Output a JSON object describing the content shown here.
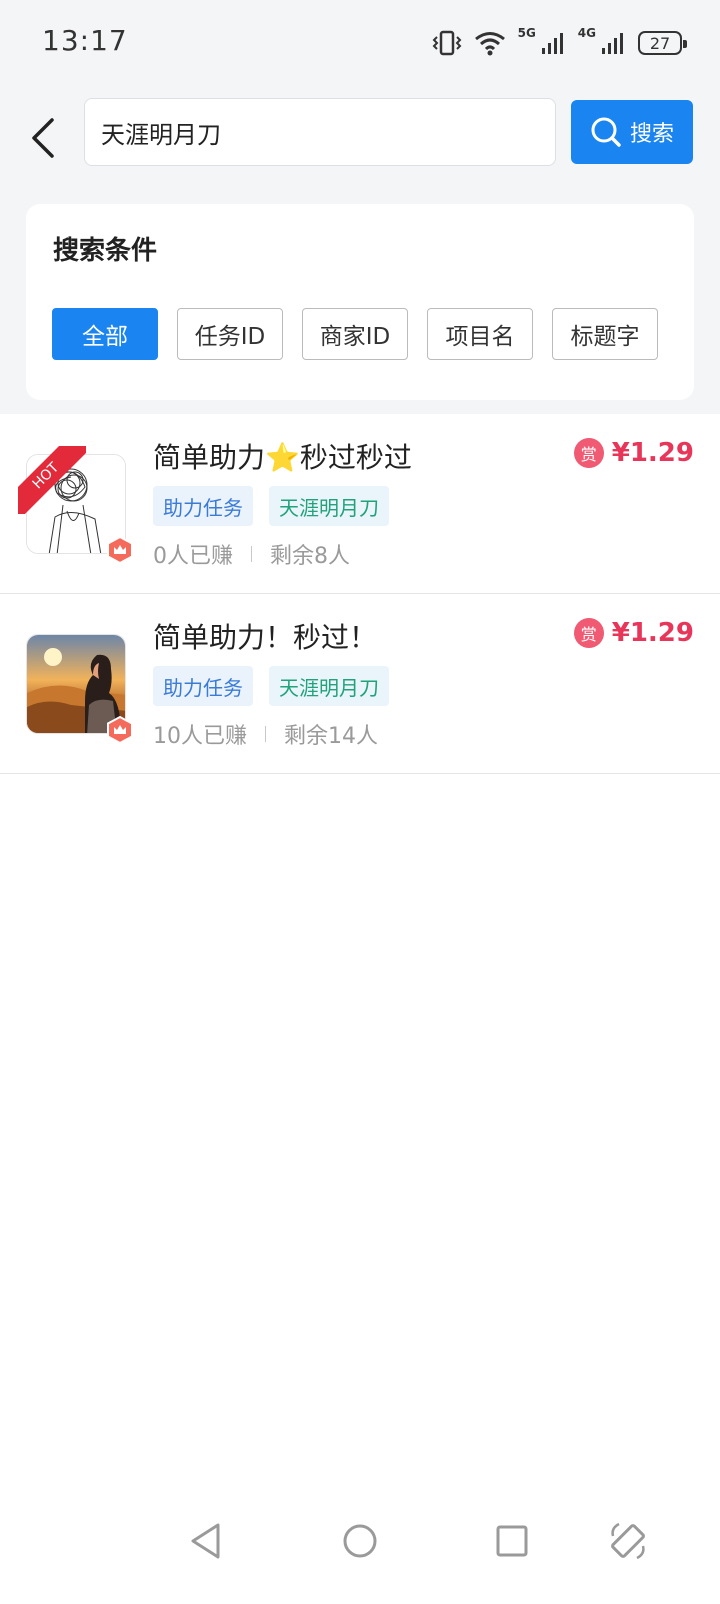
{
  "status_bar": {
    "time": "13:17",
    "network_5g": "5G",
    "network_4g": "4G",
    "battery": "27"
  },
  "search": {
    "query": "天涯明月刀",
    "button_label": "搜索"
  },
  "filters": {
    "title": "搜索条件",
    "options": [
      "全部",
      "任务ID",
      "商家ID",
      "项目名",
      "标题字"
    ],
    "selected": "全部"
  },
  "tasks": [
    {
      "title": "简单助力⭐秒过秒过",
      "reward_badge": "赏",
      "reward": "¥1.29",
      "tags": [
        "助力任务",
        "天涯明月刀"
      ],
      "earned": "0人已赚",
      "remaining": "剩余8人",
      "hot_label": "HOT"
    },
    {
      "title": "简单助力！秒过！",
      "reward_badge": "赏",
      "reward": "¥1.29",
      "tags": [
        "助力任务",
        "天涯明月刀"
      ],
      "earned": "10人已赚",
      "remaining": "剩余14人"
    }
  ],
  "colors": {
    "accent": "#1a84f0",
    "price": "#e8365a",
    "hot": "#e22a3a"
  },
  "icons": {
    "back": "chevron-left-icon",
    "search": "search-icon",
    "crown": "crown-icon",
    "nav_back": "triangle-back-icon",
    "nav_home": "circle-home-icon",
    "nav_recent": "square-recent-icon",
    "nav_rotate": "rotate-icon"
  }
}
